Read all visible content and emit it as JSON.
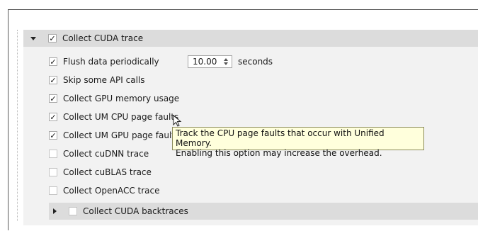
{
  "section": {
    "header_label": "Collect CUDA trace",
    "header_checked": true,
    "options": [
      {
        "label": "Flush data periodically",
        "checked": true
      },
      {
        "label": "Skip some API calls",
        "checked": true
      },
      {
        "label": "Collect GPU memory usage",
        "checked": true
      },
      {
        "label": "Collect UM CPU page faults",
        "checked": true
      },
      {
        "label": "Collect UM GPU page faults",
        "checked": true
      },
      {
        "label": "Collect cuDNN trace",
        "checked": false
      },
      {
        "label": "Collect cuBLAS trace",
        "checked": false
      },
      {
        "label": "Collect OpenACC trace",
        "checked": false
      }
    ],
    "flush_interval": {
      "value": "10.00",
      "units": "seconds"
    },
    "subsection_label": "Collect CUDA backtraces",
    "subsection_checked": false
  },
  "tooltip": {
    "line1": "Track the CPU page faults that occur with Unified Memory.",
    "line2": "Enabling this option may increase the overhead."
  },
  "colors": {
    "header_bg": "#dcdcdc",
    "panel_bg": "#f2f2f2",
    "tooltip_bg": "#ffffdc"
  },
  "check_glyph": "✓"
}
